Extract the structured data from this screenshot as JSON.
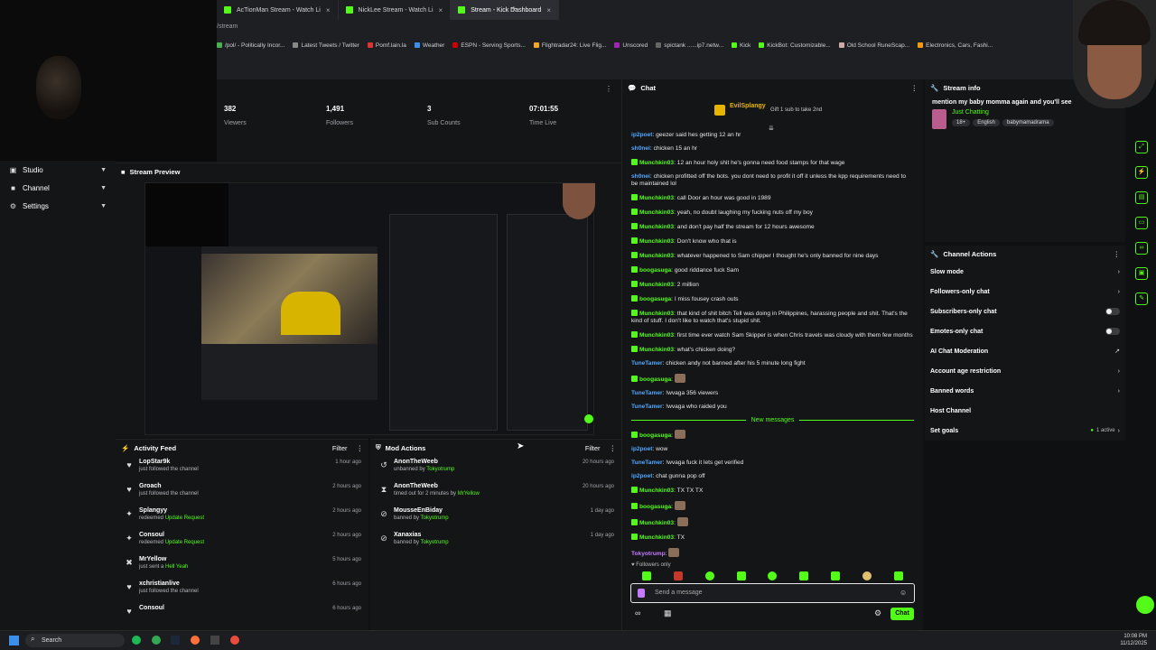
{
  "browser": {
    "tabs": [
      {
        "label": "AcTionMan Stream - Watch Li",
        "active": false
      },
      {
        "label": "NickLee Stream - Watch Li",
        "active": false
      },
      {
        "label": "Stream - Kick Dashboard",
        "active": true
      }
    ],
    "address": "/stream",
    "bookmarks": [
      "/pol/ - Politically Incor...",
      "Latest Tweets / Twitter",
      "Pomf.lain.la",
      "Weather",
      "ESPN - Serving Sports...",
      "Flightradar24: Live Flig...",
      "Unscored",
      "spictank ......ip7.netw...",
      "Kick",
      "KickBot: Customizable...",
      "Old School RuneScap...",
      "Electronics, Cars, Fashi..."
    ]
  },
  "sidebar": {
    "items": [
      {
        "label": "Studio"
      },
      {
        "label": "Channel"
      },
      {
        "label": "Settings"
      }
    ]
  },
  "stats": [
    {
      "value": "382",
      "label": "Viewers"
    },
    {
      "value": "1,491",
      "label": "Followers"
    },
    {
      "value": "3",
      "label": "Sub Counts"
    },
    {
      "value": "07:01:55",
      "label": "Time Live"
    }
  ],
  "preview": {
    "title": "Stream Preview"
  },
  "activity": {
    "title": "Activity Feed",
    "filter": "Filter",
    "rows": [
      {
        "icon": "heart-icon",
        "user": "LopStar9k",
        "action": "just followed the channel",
        "highlight": "",
        "time": "1 hour ago"
      },
      {
        "icon": "heart-icon",
        "user": "Groach",
        "action": "just followed the channel",
        "highlight": "",
        "time": "2 hours ago"
      },
      {
        "icon": "points-icon",
        "user": "Splangyy",
        "action": "redeemed",
        "highlight": "Update Request",
        "time": "2 hours ago"
      },
      {
        "icon": "points-icon",
        "user": "Consoul",
        "action": "redeemed",
        "highlight": "Update Request",
        "time": "2 hours ago"
      },
      {
        "icon": "kick-icon",
        "user": "MrYellow",
        "action": "just sent a",
        "highlight": "Hell Yeah",
        "time": "5 hours ago"
      },
      {
        "icon": "heart-icon",
        "user": "xchristianlive",
        "action": "just followed the channel",
        "highlight": "",
        "time": "6 hours ago"
      },
      {
        "icon": "heart-icon",
        "user": "Consoul",
        "action": "",
        "highlight": "",
        "time": "6 hours ago"
      }
    ]
  },
  "mod_actions": {
    "title": "Mod Actions",
    "filter": "Filter",
    "rows": [
      {
        "icon": "undo-icon",
        "user": "AnonTheWeeb",
        "action": "unbanned by",
        "by": "Tokyotrump",
        "time": "20 hours ago"
      },
      {
        "icon": "hourglass-icon",
        "user": "AnonTheWeeb",
        "action": "timed out for 2 minutes by",
        "by": "MrYellow",
        "time": "20 hours ago"
      },
      {
        "icon": "ban-icon",
        "user": "MousseEnBiday",
        "action": "banned by",
        "by": "Tokyotrump",
        "time": "1 day ago"
      },
      {
        "icon": "ban-icon",
        "user": "Xanaxias",
        "action": "banned by",
        "by": "Tokyotrump",
        "time": "1 day ago"
      }
    ]
  },
  "chat": {
    "title": "Chat",
    "pinned_user": "EvilSplangy",
    "pinned_text": "Gift 1 sub to take 2nd",
    "messages": [
      {
        "user": "ip2poet",
        "color": "blue",
        "badge": false,
        "text": "geezer said hes getting 12 an hr"
      },
      {
        "user": "sh0nei",
        "color": "blue",
        "badge": false,
        "text": "chicken 15 an hr"
      },
      {
        "user": "Munchkin03",
        "color": "green",
        "badge": true,
        "text": "12 an hour holy shit he's gonna need food stamps for that wage"
      },
      {
        "user": "sh0nei",
        "color": "blue",
        "badge": false,
        "text": "chicken profitted off the bots. you dont need to profit it off it unless the kpp requirements need to be maintained lol"
      },
      {
        "user": "Munchkin03",
        "color": "green",
        "badge": true,
        "text": "call Door an hour was good in 1989"
      },
      {
        "user": "Munchkin03",
        "color": "green",
        "badge": true,
        "text": "yeah, no doubt laughing my fucking nuts off my boy"
      },
      {
        "user": "Munchkin03",
        "color": "green",
        "badge": true,
        "text": "and don't pay half the stream for 12 hours awesome"
      },
      {
        "user": "Munchkin03",
        "color": "green",
        "badge": true,
        "text": "Don't know who that is"
      },
      {
        "user": "Munchkin03",
        "color": "green",
        "badge": true,
        "text": "whatever happened to Sam chipper I thought he's only banned for nine days"
      },
      {
        "user": "boogasuga",
        "color": "green",
        "badge": true,
        "text": "good riddance fuck Sam"
      },
      {
        "user": "Munchkin03",
        "color": "green",
        "badge": true,
        "text": "2 million"
      },
      {
        "user": "boogasuga",
        "color": "green",
        "badge": true,
        "text": "I miss fousey crash outs"
      },
      {
        "user": "Munchkin03",
        "color": "green",
        "badge": true,
        "text": "that kind of shit bitch Tell was doing in Philippines, harassing people and shit. That's the kind of stuff. I don't like to watch that's stupid shit."
      },
      {
        "user": "Munchkin03",
        "color": "green",
        "badge": true,
        "text": "first time ever watch Sam Skipper is when Chris travels was cloudy with them few months"
      },
      {
        "user": "Munchkin03",
        "color": "green",
        "badge": true,
        "text": "what's chicken doing?"
      },
      {
        "user": "TuneTamer",
        "color": "blue",
        "badge": false,
        "text": "chicken andy not banned after his 5 minute long fight"
      },
      {
        "user": "boogasuga",
        "color": "green",
        "badge": true,
        "text": ""
      },
      {
        "user": "TuneTamer",
        "color": "blue",
        "badge": false,
        "text": "!wvaga 356 viewers"
      },
      {
        "user": "TuneTamer",
        "color": "blue",
        "badge": false,
        "text": "!wvaga who raided you"
      }
    ],
    "new_messages_label": "New messages",
    "new_messages": [
      {
        "user": "boogasuga",
        "color": "green",
        "badge": true,
        "text": ""
      },
      {
        "user": "ip2poet",
        "color": "blue",
        "badge": false,
        "text": "wow"
      },
      {
        "user": "TuneTamer",
        "color": "blue",
        "badge": false,
        "text": "!wvaga fuck it lets get verified"
      },
      {
        "user": "ip2poet",
        "color": "blue",
        "badge": false,
        "text": "chat gunna pop off"
      },
      {
        "user": "Munchkin03",
        "color": "green",
        "badge": true,
        "text": "TX TX TX"
      },
      {
        "user": "boogasuga",
        "color": "green",
        "badge": true,
        "text": ""
      },
      {
        "user": "Munchkin03",
        "color": "green",
        "badge": true,
        "text": ""
      },
      {
        "user": "Munchkin03",
        "color": "green",
        "badge": true,
        "text": "TX"
      },
      {
        "user": "Tokyotrump",
        "color": "purple",
        "badge": false,
        "text": ""
      }
    ],
    "mode_label": "Followers only",
    "input_placeholder": "Send a message",
    "send_label": "Chat"
  },
  "stream_info": {
    "title": "Stream info",
    "stream_title": "mention my baby momma again and you'll see",
    "category": "Just Chatting",
    "tags": [
      "18+",
      "English",
      "babymamadrama"
    ]
  },
  "channel_actions": {
    "title": "Channel Actions",
    "rows": [
      {
        "label": "Slow mode",
        "control": "chevron"
      },
      {
        "label": "Followers-only chat",
        "control": "chevron"
      },
      {
        "label": "Subscribers-only chat",
        "control": "toggle"
      },
      {
        "label": "Emotes-only chat",
        "control": "toggle"
      },
      {
        "label": "AI Chat Moderation",
        "control": "external"
      },
      {
        "label": "Account age restriction",
        "control": "chevron"
      },
      {
        "label": "Banned words",
        "control": "chevron"
      },
      {
        "label": "Host Channel",
        "control": "none"
      },
      {
        "label": "Set goals",
        "control": "chevron",
        "extra": "1 active"
      }
    ]
  },
  "taskbar": {
    "search": "Search",
    "time": "10:08 PM",
    "date": "11/12/2025"
  },
  "colors": {
    "accent": "#53fc18",
    "panel": "#141517",
    "background": "#0f1012"
  }
}
